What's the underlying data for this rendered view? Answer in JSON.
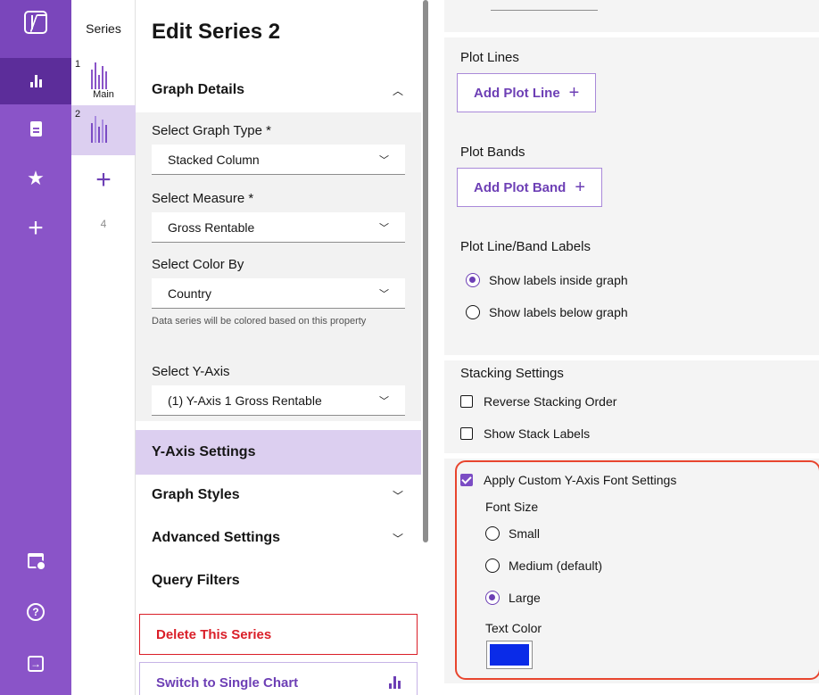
{
  "nav": {
    "items": [
      {
        "name": "logo",
        "icon": "k-logo-icon"
      },
      {
        "name": "charts",
        "icon": "bar-chart-icon",
        "active": true
      },
      {
        "name": "reports",
        "icon": "document-icon"
      },
      {
        "name": "favorites",
        "icon": "star-icon"
      },
      {
        "name": "create",
        "icon": "plus-icon"
      },
      {
        "name": "dashboard-settings",
        "icon": "calendar-settings-icon"
      },
      {
        "name": "help",
        "icon": "help-icon"
      },
      {
        "name": "logout",
        "icon": "logout-icon"
      }
    ]
  },
  "series_panel": {
    "title": "Series",
    "slots": [
      {
        "number": "1",
        "caption": "Main"
      },
      {
        "number": "2",
        "caption": ""
      }
    ],
    "add_icon": "plus-icon",
    "slot4_number": "4"
  },
  "edit": {
    "title": "Edit Series 2",
    "graph_details": {
      "header": "Graph Details",
      "graph_type_label": "Select Graph Type *",
      "graph_type_value": "Stacked Column",
      "measure_label": "Select Measure  *",
      "measure_value": "Gross Rentable",
      "color_by_label": "Select Color By",
      "color_by_value": "Country",
      "color_by_helper": "Data series will be colored based on this property",
      "y_axis_label": "Select Y-Axis",
      "y_axis_value": "(1) Y-Axis 1 Gross Rentable"
    },
    "sections": {
      "y_axis_settings": "Y-Axis Settings",
      "graph_styles": "Graph Styles",
      "advanced_settings": "Advanced Settings",
      "query_filters": "Query Filters"
    },
    "delete_label": "Delete This Series",
    "switch_label": "Switch to Single Chart"
  },
  "yaxis": {
    "plot_lines_label": "Plot Lines",
    "add_plot_line": "Add Plot Line",
    "plot_bands_label": "Plot Bands",
    "add_plot_band": "Add Plot Band",
    "labels_heading": "Plot Line/Band Labels",
    "label_inside": "Show labels inside graph",
    "label_below": "Show labels below graph",
    "stacking_heading": "Stacking Settings",
    "reverse_stacking": "Reverse Stacking Order",
    "show_stack_labels": "Show Stack Labels",
    "apply_custom_font": "Apply Custom Y-Axis Font Settings",
    "font_size_label": "Font Size",
    "font_small": "Small",
    "font_medium": "Medium (default)",
    "font_large": "Large",
    "text_color_label": "Text Color",
    "text_color_value": "#0a2be8",
    "accent_color": "#6d3fb5",
    "highlight_color": "#e8452e"
  }
}
